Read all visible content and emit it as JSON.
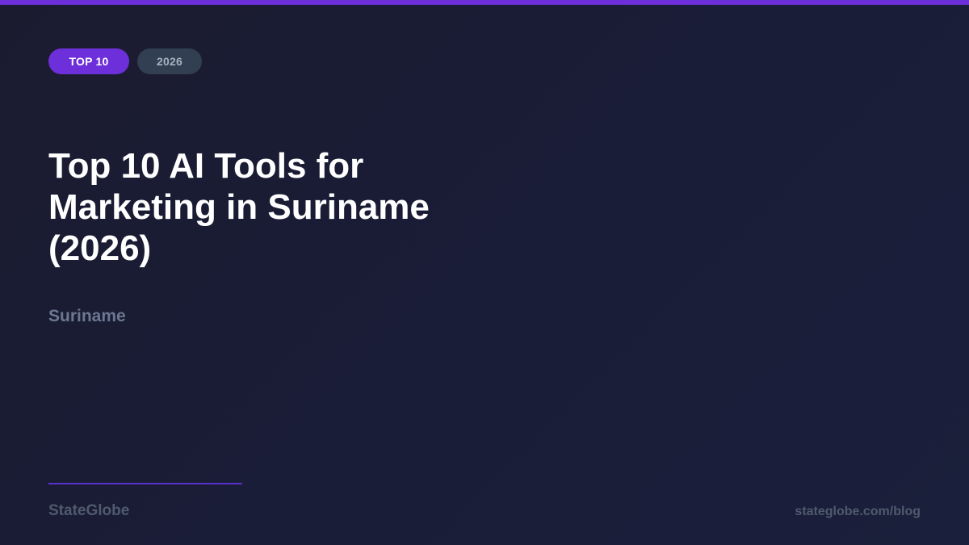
{
  "badges": {
    "primary": "TOP 10",
    "secondary": "2026"
  },
  "title": "Top 10 AI Tools for Marketing in Suriname (2026)",
  "subtitle": "Suriname",
  "footer": {
    "brand": "StateGlobe",
    "url": "stateglobe.com/blog"
  },
  "colors": {
    "accent": "#6d2fd9",
    "background": "#1b1d36",
    "title": "#ffffff",
    "muted": "#6b7891"
  }
}
